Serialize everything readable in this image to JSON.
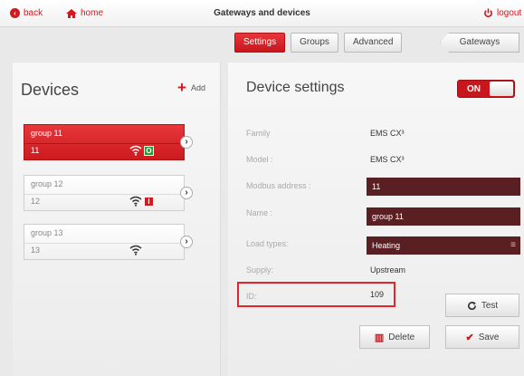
{
  "topbar": {
    "back_label": "back",
    "home_label": "home",
    "title": "Gateways and devices",
    "logout_label": "logout"
  },
  "tabs": [
    {
      "label": "Settings",
      "active": true
    },
    {
      "label": "Groups",
      "active": false
    },
    {
      "label": "Advanced",
      "active": false
    }
  ],
  "gateways_tab": "Gateways",
  "devices": {
    "heading": "Devices",
    "add_label": "Add",
    "groups": [
      {
        "name": "group 11",
        "id": "11",
        "selected": true,
        "status": "O",
        "status_color": "#1fa03a"
      },
      {
        "name": "group 12",
        "id": "12",
        "selected": false,
        "status": "I",
        "status_color": "#d4181e"
      },
      {
        "name": "group 13",
        "id": "13",
        "selected": false,
        "status": "",
        "status_color": ""
      }
    ]
  },
  "settings": {
    "heading": "Device settings",
    "toggle_label": "ON",
    "family_label": "Family",
    "family_value": "EMS CX³",
    "model_label": "Model :",
    "model_value": "EMS CX³",
    "modbus_label": "Modbus address :",
    "modbus_value": "11",
    "name_label": "Name :",
    "name_value": "group 11",
    "load_label": "Load types:",
    "load_value": "Heating",
    "supply_label": "Supply:",
    "supply_value": "Upstream",
    "id_label": "ID:",
    "id_value": "109",
    "test_label": "Test",
    "delete_label": "Delete",
    "save_label": "Save"
  },
  "colors": {
    "accent": "#d4181e",
    "field": "#5a1f22",
    "ok": "#1fa03a"
  }
}
